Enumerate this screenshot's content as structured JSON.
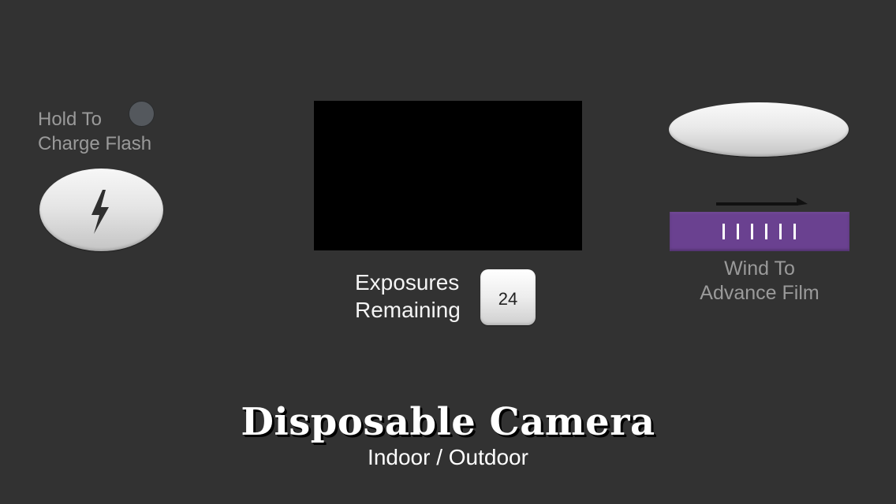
{
  "flash": {
    "hint": "Hold To\nCharge Flash",
    "button_icon": "lightning-bolt-icon",
    "indicator_color": "#54585d"
  },
  "viewfinder": {
    "color": "#000000"
  },
  "exposures": {
    "label": "Exposures\nRemaining",
    "count": "24"
  },
  "shutter": {
    "icon": "shutter-button"
  },
  "wind": {
    "arrow_icon": "right-arrow-icon",
    "wheel_color": "#6a4190",
    "hint": "Wind To\nAdvance Film"
  },
  "app": {
    "title": "Disposable Camera",
    "subtitle": "Indoor / Outdoor"
  }
}
